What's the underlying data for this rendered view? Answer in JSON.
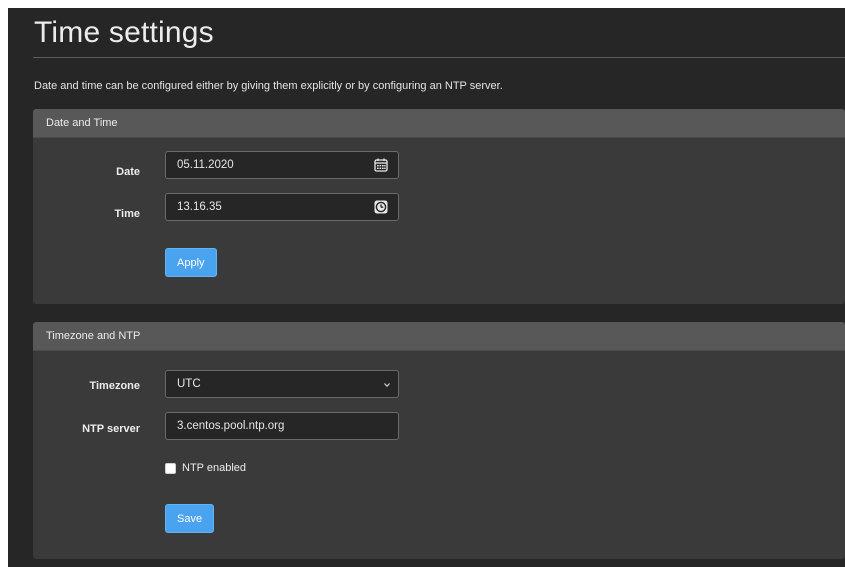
{
  "page": {
    "title": "Time settings",
    "description": "Date and time can be configured either by giving them explicitly or by configuring an NTP server."
  },
  "date_time": {
    "header": "Date and Time",
    "date_label": "Date",
    "date_value": "05.11.2020",
    "date_icon": "calendar-icon",
    "time_label": "Time",
    "time_value": "13.16.35",
    "time_icon": "clock-icon",
    "apply_label": "Apply"
  },
  "timezone_ntp": {
    "header": "Timezone and NTP",
    "timezone_label": "Timezone",
    "timezone_value": "UTC",
    "timezone_icon": "chevron-down-icon",
    "ntp_label": "NTP server",
    "ntp_value": "3.centos.pool.ntp.org",
    "ntp_enabled_label": "NTP enabled",
    "ntp_enabled": false,
    "save_label": "Save"
  },
  "colors": {
    "background": "#262626",
    "panel": "#3a3a3a",
    "panel_header": "#585858",
    "button": "#4aa3ef"
  }
}
